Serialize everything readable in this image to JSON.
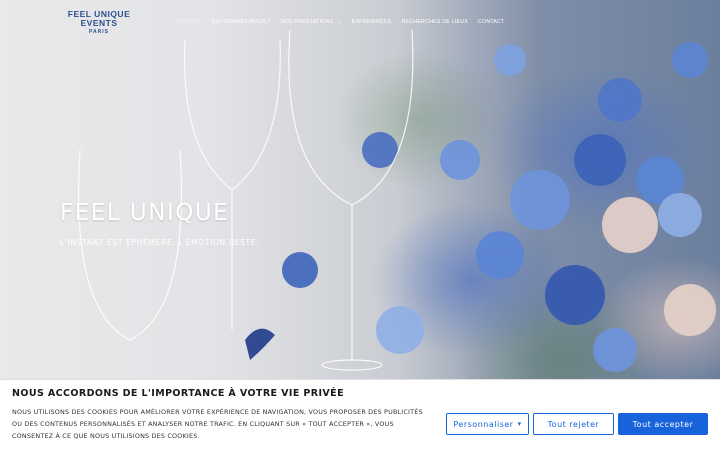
{
  "header": {
    "logo": {
      "line1": "FEEL UNIQUE",
      "line2": "EVENTS",
      "line3": "PARIS"
    },
    "nav": [
      {
        "label": "Accueil"
      },
      {
        "label": "Qui sommes-nous ?"
      },
      {
        "label": "Nos prestations"
      },
      {
        "label": "Expériences"
      },
      {
        "label": "Recherches de lieux"
      },
      {
        "label": "Contact"
      }
    ]
  },
  "hero": {
    "title": "FEEL UNIQUE",
    "subtitle": "L'instant est éphémère, l'émotion reste."
  },
  "cookie": {
    "title": "NOUS ACCORDONS DE L'IMPORTANCE À VOTRE VIE PRIVÉE",
    "text": "Nous utilisons des cookies pour améliorer votre expérience de navigation, vous proposer des publicités ou des contenus personnalisés et analyser notre trafic. En cliquant sur « Tout accepter », vous consentez à ce que nous utilisions des cookies.",
    "customize_label": "Personnaliser",
    "reject_label": "Tout rejeter",
    "accept_label": "Tout accepter"
  },
  "colors": {
    "accent": "#1863dc",
    "logo": "#2d4f8f"
  }
}
